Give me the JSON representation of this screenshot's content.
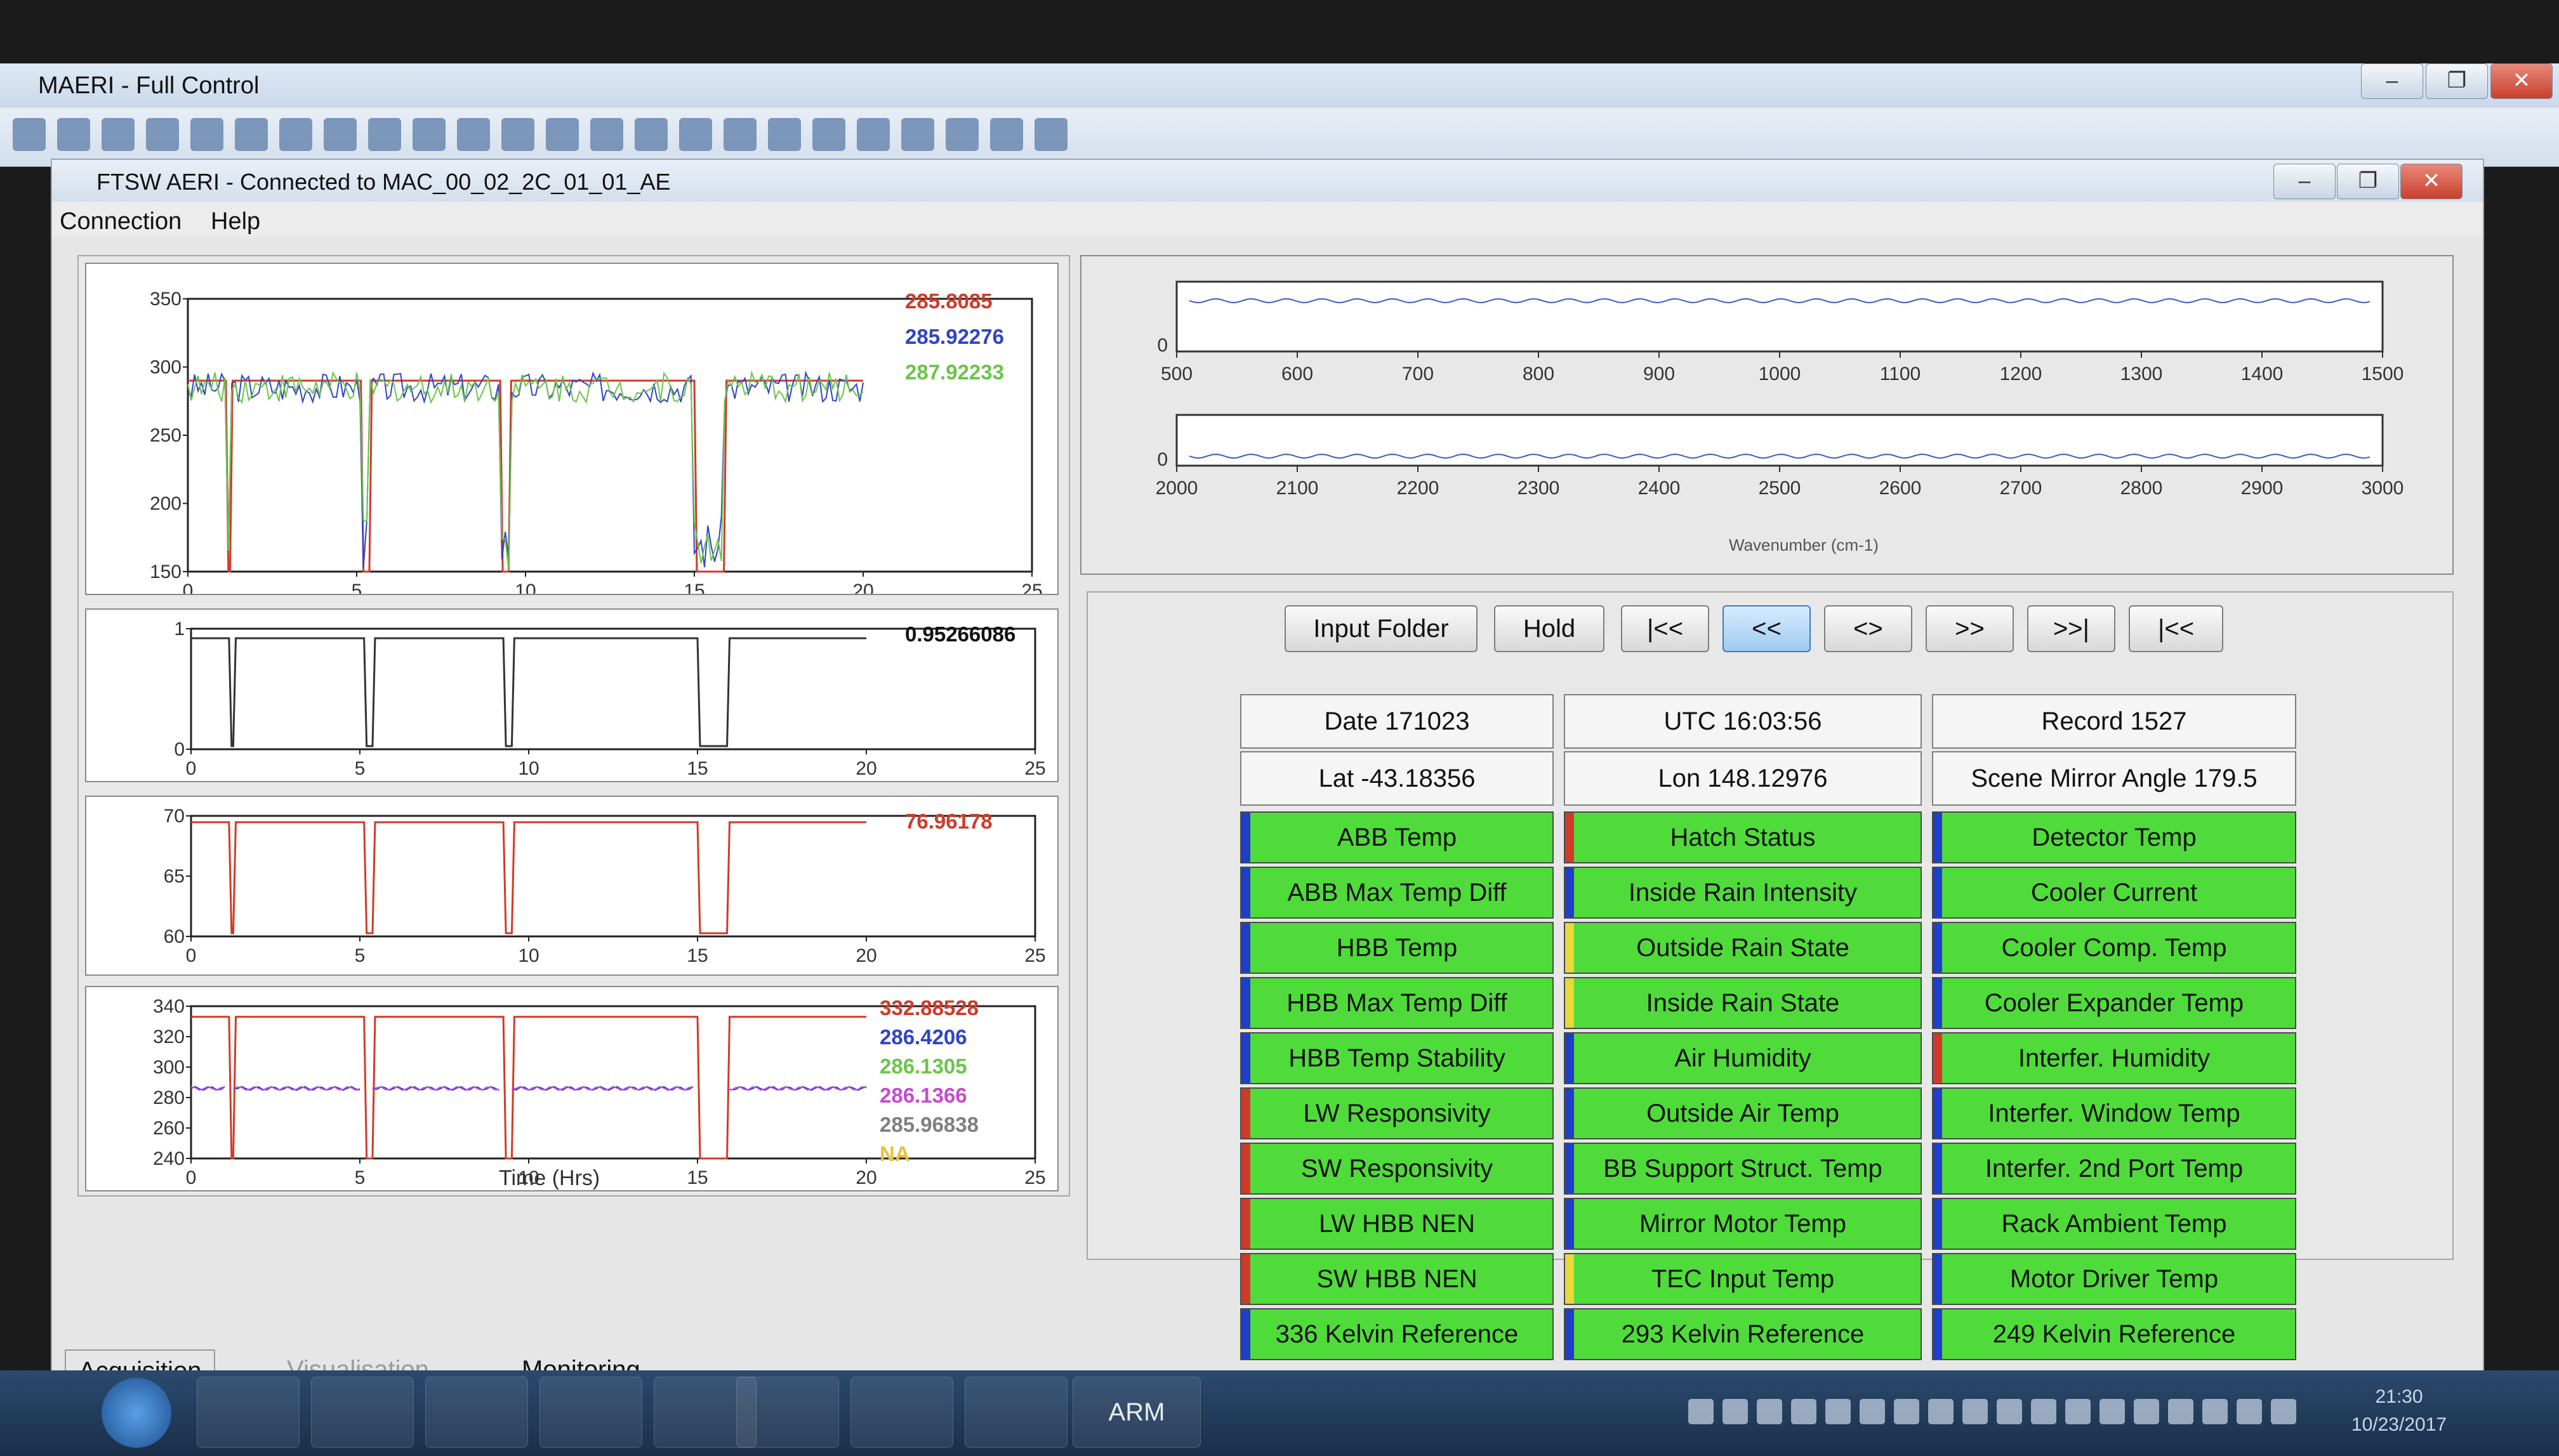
{
  "outer_window": {
    "title": "MAERI - Full Control",
    "controls": [
      "–",
      "❐",
      "✕"
    ]
  },
  "inner_window": {
    "title": "FTSW AERI - Connected to MAC_00_02_2C_01_01_AE",
    "controls": [
      "–",
      "❐",
      "✕"
    ]
  },
  "menu": [
    "Connection",
    "Help"
  ],
  "plots": {
    "p1": {
      "yticks": [
        "350",
        "300",
        "250",
        "200",
        "150"
      ],
      "xticks": [
        "0",
        "5",
        "10",
        "15",
        "20",
        "25"
      ],
      "values": [
        "285.8085",
        "285.92276",
        "287.92233"
      ],
      "colors": [
        "#d03a2a",
        "#2f44c8",
        "#6cc44a"
      ]
    },
    "p2": {
      "yticks": [
        "1",
        "0"
      ],
      "xticks": [
        "0",
        "5",
        "10",
        "15",
        "20",
        "25"
      ],
      "values": [
        "0.95266086"
      ],
      "colors": [
        "#111111"
      ]
    },
    "p3": {
      "yticks": [
        "70",
        "65",
        "60"
      ],
      "xticks": [
        "0",
        "5",
        "10",
        "15",
        "20",
        "25"
      ],
      "values": [
        "76.96178"
      ],
      "colors": [
        "#d03a2a"
      ]
    },
    "p4": {
      "yticks": [
        "340",
        "320",
        "300",
        "280",
        "260",
        "240"
      ],
      "xticks": [
        "0",
        "5",
        "10",
        "15",
        "20",
        "25"
      ],
      "values": [
        "332.88528",
        "286.4206",
        "286.1305",
        "286.1366",
        "285.96838",
        "NA"
      ],
      "colors": [
        "#d03a2a",
        "#2f44c8",
        "#6cc44a",
        "#c84ad0",
        "#808080",
        "#e8c23a"
      ],
      "xlabel": "Time (Hrs)"
    }
  },
  "spectrum": {
    "top": {
      "y0": "0",
      "xticks": [
        "500",
        "600",
        "700",
        "800",
        "900",
        "1000",
        "1100",
        "1200",
        "1300",
        "1400",
        "1500"
      ]
    },
    "bottom": {
      "y0": "0",
      "xticks": [
        "2000",
        "2100",
        "2200",
        "2300",
        "2400",
        "2500",
        "2600",
        "2700",
        "2800",
        "2900",
        "3000"
      ],
      "xlabel": "Wavenumber (cm-1)"
    }
  },
  "nav": {
    "input_folder": "Input Folder",
    "hold": "Hold",
    "first": "|<<",
    "prev_fast": "<<",
    "center": "<>",
    "next_fast": ">>",
    "last": ">>|",
    "reset": "|<<"
  },
  "info": {
    "date": "Date 171023",
    "utc": "UTC 16:03:56",
    "record": "Record 1527",
    "lat": "Lat -43.18356",
    "lon": "Lon 148.12976",
    "scene": "Scene Mirror Angle 179.5"
  },
  "status": {
    "col1": [
      {
        "label": "ABB Temp",
        "bar": "#1f3fc8"
      },
      {
        "label": "ABB Max Temp Diff",
        "bar": "#1f3fc8"
      },
      {
        "label": "HBB Temp",
        "bar": "#1f3fc8"
      },
      {
        "label": "HBB Max Temp Diff",
        "bar": "#1f3fc8"
      },
      {
        "label": "HBB Temp Stability",
        "bar": "#1f3fc8"
      },
      {
        "label": "LW Responsivity",
        "bar": "#d03a2a"
      },
      {
        "label": "SW Responsivity",
        "bar": "#d03a2a"
      },
      {
        "label": "LW HBB NEN",
        "bar": "#d03a2a"
      },
      {
        "label": "SW HBB NEN",
        "bar": "#d03a2a"
      },
      {
        "label": "336 Kelvin Reference",
        "bar": "#1f3fc8"
      }
    ],
    "col2": [
      {
        "label": "Hatch Status",
        "bar": "#d03a2a"
      },
      {
        "label": "Inside Rain Intensity",
        "bar": "#1f3fc8"
      },
      {
        "label": "Outside Rain State",
        "bar": "#e8d83a"
      },
      {
        "label": "Inside Rain State",
        "bar": "#e8d83a"
      },
      {
        "label": "Air Humidity",
        "bar": "#1f3fc8"
      },
      {
        "label": "Outside Air Temp",
        "bar": "#1f3fc8"
      },
      {
        "label": "BB Support Struct. Temp",
        "bar": "#1f3fc8"
      },
      {
        "label": "Mirror Motor Temp",
        "bar": "#1f3fc8"
      },
      {
        "label": "TEC Input Temp",
        "bar": "#e8d83a"
      },
      {
        "label": "293 Kelvin Reference",
        "bar": "#1f3fc8"
      }
    ],
    "col3": [
      {
        "label": "Detector Temp",
        "bar": "#1f3fc8"
      },
      {
        "label": "Cooler Current",
        "bar": "#1f3fc8"
      },
      {
        "label": "Cooler Comp. Temp",
        "bar": "#1f3fc8"
      },
      {
        "label": "Cooler Expander Temp",
        "bar": "#1f3fc8"
      },
      {
        "label": "Interfer. Humidity",
        "bar": "#d03a2a"
      },
      {
        "label": "Interfer. Window Temp",
        "bar": "#1f3fc8"
      },
      {
        "label": "Interfer. 2nd Port Temp",
        "bar": "#1f3fc8"
      },
      {
        "label": "Rack Ambient Temp",
        "bar": "#1f3fc8"
      },
      {
        "label": "Motor Driver Temp",
        "bar": "#1f3fc8"
      },
      {
        "label": "249 Kelvin Reference",
        "bar": "#1f3fc8"
      }
    ]
  },
  "tabs": [
    "Acquisition",
    "Visualisation",
    "Monitoring"
  ],
  "taskbar": {
    "arm_label": "ARM",
    "clock": "21:30",
    "date": "10/23/2017"
  }
}
